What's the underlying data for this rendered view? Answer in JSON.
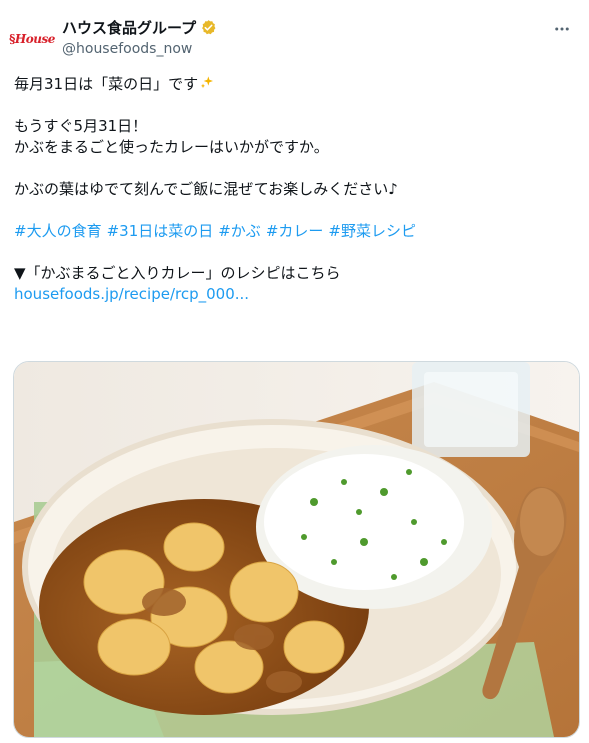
{
  "author": {
    "logo_text": "House",
    "display_name": "ハウス食品グループ",
    "handle": "@housefoods_now",
    "verified_color": "#e8b829"
  },
  "tweet": {
    "lines": [
      "毎月31日は「菜の日」です",
      "",
      "もうすぐ5月31日！",
      "かぶをまるごと使ったカレーはいかがですか。",
      "",
      "かぶの葉はゆでて刻んでご飯に混ぜてお楽しみください♪",
      ""
    ],
    "hashtags": [
      "#大人の食育",
      "#31日は菜の日",
      "#かぶ",
      "#カレー",
      "#野菜レシピ"
    ],
    "recipe_line": "▼「かぶまるごと入りカレー」のレシピはこちら",
    "link": "housefoods.jp/recipe/rcp_000..."
  },
  "media": {
    "icon": "curry-photo"
  },
  "colors": {
    "link": "#1d9bf0",
    "brand_red": "#d8202a"
  }
}
